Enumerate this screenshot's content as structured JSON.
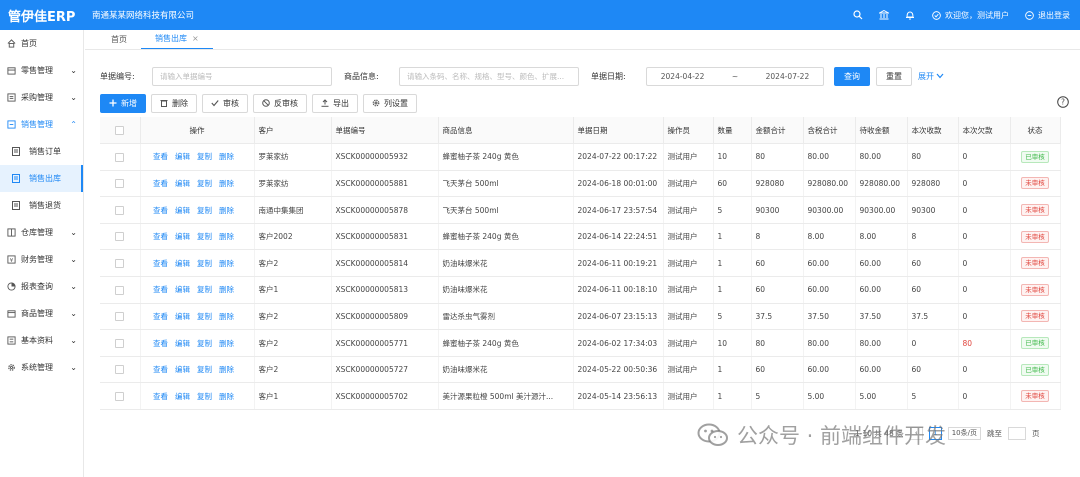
{
  "header": {
    "logo": "管伊佳ERP",
    "company": "南通某某网络科技有限公司",
    "welcome": "欢迎您，测试用户",
    "logout": "退出登录"
  },
  "sidebar": {
    "items": [
      {
        "label": "首页",
        "icon": "home-icon",
        "arrow": ""
      },
      {
        "label": "零售管理",
        "icon": "retail-icon",
        "arrow": "⌄"
      },
      {
        "label": "采购管理",
        "icon": "purchase-icon",
        "arrow": "⌄"
      },
      {
        "label": "销售管理",
        "icon": "sales-icon",
        "arrow": "⌃"
      }
    ],
    "sub": [
      {
        "label": "销售订单"
      },
      {
        "label": "销售出库"
      },
      {
        "label": "销售退货"
      }
    ],
    "items2": [
      {
        "label": "仓库管理",
        "icon": "warehouse-icon",
        "arrow": "⌄"
      },
      {
        "label": "财务管理",
        "icon": "finance-icon",
        "arrow": "⌄"
      },
      {
        "label": "报表查询",
        "icon": "report-icon",
        "arrow": "⌄"
      },
      {
        "label": "商品管理",
        "icon": "goods-icon",
        "arrow": "⌄"
      },
      {
        "label": "基本资料",
        "icon": "basic-icon",
        "arrow": "⌄"
      },
      {
        "label": "系统管理",
        "icon": "system-icon",
        "arrow": "⌄"
      }
    ]
  },
  "tabs": [
    {
      "label": "首页"
    },
    {
      "label": "销售出库",
      "close": "×"
    }
  ],
  "filter": {
    "doc_no_label": "单据编号:",
    "doc_no_placeholder": "请输入单据编号",
    "goods_label": "商品信息:",
    "goods_placeholder": "请输入条码、名称、规格、型号、颜色、扩展...",
    "date_label": "单据日期:",
    "date_start": "2024-04-22",
    "date_sep": "~",
    "date_end": "2024-07-22",
    "query": "查询",
    "reset": "重置",
    "expand": "展开"
  },
  "toolbar": {
    "add": "新增",
    "delete": "删除",
    "audit": "审核",
    "unaudit": "反审核",
    "export": "导出",
    "columns": "列设置"
  },
  "table": {
    "headers": [
      "操作",
      "客户",
      "单据编号",
      "商品信息",
      "单据日期",
      "操作员",
      "数量",
      "金额合计",
      "含税合计",
      "待收金额",
      "本次收款",
      "本次欠款",
      "状态"
    ],
    "ops": [
      "查看",
      "编辑",
      "复制",
      "删除"
    ],
    "rows": [
      {
        "customer": "罗莱家纺",
        "no": "XSCK00000005932",
        "goods": "蜂蜜柚子茶 240g 黄色",
        "date": "2024-07-22 00:17:22",
        "operator": "测试用户",
        "qty": "10",
        "amount": "80",
        "tax": "80.00",
        "pending": "80.00",
        "received": "80",
        "owed": "0",
        "status": "已审核",
        "ok": true
      },
      {
        "customer": "罗莱家纺",
        "no": "XSCK00000005881",
        "goods": "飞天茅台 500ml",
        "date": "2024-06-18 00:01:00",
        "operator": "测试用户",
        "qty": "60",
        "amount": "928080",
        "tax": "928080.00",
        "pending": "928080.00",
        "received": "928080",
        "owed": "0",
        "status": "未审核",
        "ok": false
      },
      {
        "customer": "南通中集集团",
        "no": "XSCK00000005878",
        "goods": "飞天茅台 500ml",
        "date": "2024-06-17 23:57:54",
        "operator": "测试用户",
        "qty": "5",
        "amount": "90300",
        "tax": "90300.00",
        "pending": "90300.00",
        "received": "90300",
        "owed": "0",
        "status": "未审核",
        "ok": false
      },
      {
        "customer": "客户2002",
        "no": "XSCK00000005831",
        "goods": "蜂蜜柚子茶 240g 黄色",
        "date": "2024-06-14 22:24:51",
        "operator": "测试用户",
        "qty": "1",
        "amount": "8",
        "tax": "8.00",
        "pending": "8.00",
        "received": "8",
        "owed": "0",
        "status": "未审核",
        "ok": false
      },
      {
        "customer": "客户2",
        "no": "XSCK00000005814",
        "goods": "奶油味爆米花",
        "date": "2024-06-11 00:19:21",
        "operator": "测试用户",
        "qty": "1",
        "amount": "60",
        "tax": "60.00",
        "pending": "60.00",
        "received": "60",
        "owed": "0",
        "status": "未审核",
        "ok": false
      },
      {
        "customer": "客户1",
        "no": "XSCK00000005813",
        "goods": "奶油味爆米花",
        "date": "2024-06-11 00:18:10",
        "operator": "测试用户",
        "qty": "1",
        "amount": "60",
        "tax": "60.00",
        "pending": "60.00",
        "received": "60",
        "owed": "0",
        "status": "未审核",
        "ok": false
      },
      {
        "customer": "客户2",
        "no": "XSCK00000005809",
        "goods": "雷达杀虫气雾剂",
        "date": "2024-06-07 23:15:13",
        "operator": "测试用户",
        "qty": "5",
        "amount": "37.5",
        "tax": "37.50",
        "pending": "37.50",
        "received": "37.5",
        "owed": "0",
        "status": "未审核",
        "ok": false
      },
      {
        "customer": "客户2",
        "no": "XSCK00000005771",
        "goods": "蜂蜜柚子茶 240g 黄色",
        "date": "2024-06-02 17:34:03",
        "operator": "测试用户",
        "qty": "10",
        "amount": "80",
        "tax": "80.00",
        "pending": "80.00",
        "received": "0",
        "owed": "80",
        "owedRed": true,
        "status": "已审核",
        "ok": true
      },
      {
        "customer": "客户2",
        "no": "XSCK00000005727",
        "goods": "奶油味爆米花",
        "date": "2024-05-22 00:50:36",
        "operator": "测试用户",
        "qty": "1",
        "amount": "60",
        "tax": "60.00",
        "pending": "60.00",
        "received": "60",
        "owed": "0",
        "status": "已审核",
        "ok": true
      },
      {
        "customer": "客户1",
        "no": "XSCK00000005702",
        "goods": "美汁源果粒橙 500ml 美汁源汁...",
        "date": "2024-05-14 23:56:13",
        "operator": "测试用户",
        "qty": "1",
        "amount": "5",
        "tax": "5.00",
        "pending": "5.00",
        "received": "5",
        "owed": "0",
        "status": "未审核",
        "ok": false
      }
    ]
  },
  "pagination": {
    "summary": "1-10 共 48 条",
    "current": "1",
    "per_page": "10条/页",
    "goto": "跳至",
    "page_unit": "页"
  },
  "watermark": {
    "text": "公众号 · 前端组件开发"
  },
  "colors": {
    "primary": "#1e88f5",
    "approved": "#3fb84a",
    "unapproved": "#e0443c"
  }
}
